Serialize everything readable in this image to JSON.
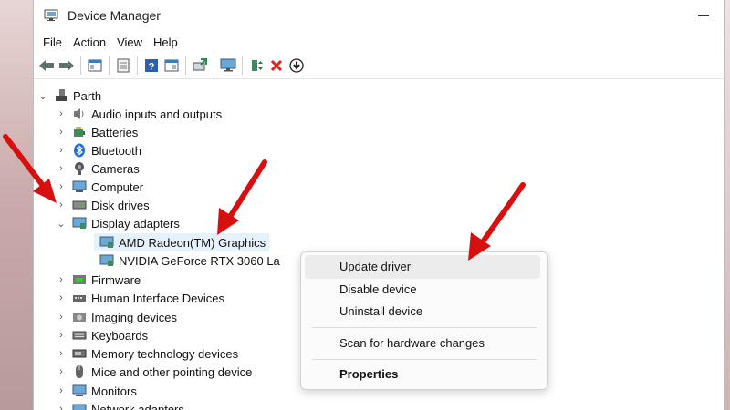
{
  "window": {
    "title": "Device Manager"
  },
  "menu": [
    "File",
    "Action",
    "View",
    "Help"
  ],
  "toolbar": [
    "back-arrow",
    "forward-arrow",
    "show-hide-tree",
    "properties",
    "help",
    "view-by",
    "update-driver",
    "monitor",
    "enable-device",
    "uninstall-device",
    "download-driver"
  ],
  "tree": {
    "root": "Parth",
    "categories": [
      {
        "label": "Audio inputs and outputs",
        "icon": "speaker-icon"
      },
      {
        "label": "Batteries",
        "icon": "battery-icon"
      },
      {
        "label": "Bluetooth",
        "icon": "bluetooth-icon"
      },
      {
        "label": "Cameras",
        "icon": "camera-icon"
      },
      {
        "label": "Computer",
        "icon": "computer-icon"
      },
      {
        "label": "Disk drives",
        "icon": "disk-icon"
      },
      {
        "label": "Display adapters",
        "icon": "display-adapter-icon"
      },
      {
        "label": "Firmware",
        "icon": "firmware-icon"
      },
      {
        "label": "Human Interface Devices",
        "icon": "hid-icon"
      },
      {
        "label": "Imaging devices",
        "icon": "imaging-icon"
      },
      {
        "label": "Keyboards",
        "icon": "keyboard-icon"
      },
      {
        "label": "Memory technology devices",
        "icon": "memory-icon"
      },
      {
        "label": "Mice and other pointing device",
        "icon": "mouse-icon"
      },
      {
        "label": "Monitors",
        "icon": "monitor-icon"
      },
      {
        "label": "Network adapters",
        "icon": "network-icon"
      }
    ],
    "display_children": [
      "AMD Radeon(TM) Graphics",
      "NVIDIA GeForce RTX 3060 La"
    ]
  },
  "context_menu": {
    "items": [
      "Update driver",
      "Disable device",
      "Uninstall device",
      "Scan for hardware changes",
      "Properties"
    ]
  },
  "colors": {
    "accent_selected": "#e5f1fb",
    "arrow_red": "#d80f0f"
  }
}
